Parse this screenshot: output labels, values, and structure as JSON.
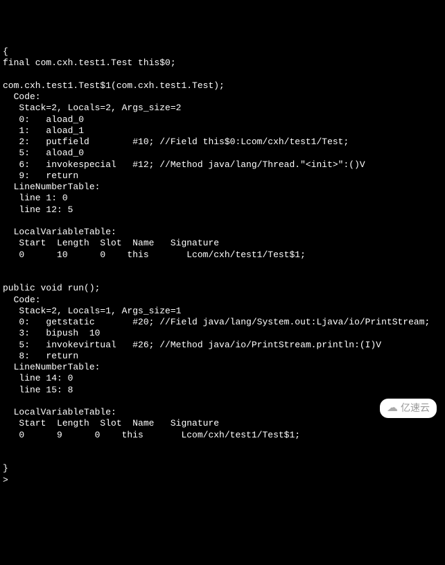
{
  "terminal": {
    "lines": [
      "{",
      "final com.cxh.test1.Test this$0;",
      "",
      "com.cxh.test1.Test$1(com.cxh.test1.Test);",
      "  Code:",
      "   Stack=2, Locals=2, Args_size=2",
      "   0:   aload_0",
      "   1:   aload_1",
      "   2:   putfield        #10; //Field this$0:Lcom/cxh/test1/Test;",
      "   5:   aload_0",
      "   6:   invokespecial   #12; //Method java/lang/Thread.\"<init>\":()V",
      "   9:   return",
      "  LineNumberTable:",
      "   line 1: 0",
      "   line 12: 5",
      "",
      "  LocalVariableTable:",
      "   Start  Length  Slot  Name   Signature",
      "   0      10      0    this       Lcom/cxh/test1/Test$1;",
      "",
      "",
      "public void run();",
      "  Code:",
      "   Stack=2, Locals=1, Args_size=1",
      "   0:   getstatic       #20; //Field java/lang/System.out:Ljava/io/PrintStream;",
      "   3:   bipush  10",
      "   5:   invokevirtual   #26; //Method java/io/PrintStream.println:(I)V",
      "   8:   return",
      "  LineNumberTable:",
      "   line 14: 0",
      "   line 15: 8",
      "",
      "  LocalVariableTable:",
      "   Start  Length  Slot  Name   Signature",
      "   0      9      0    this       Lcom/cxh/test1/Test$1;",
      "",
      "",
      "}"
    ],
    "prompt_char": ">"
  },
  "watermark": {
    "icon": "☁",
    "text": "亿速云"
  }
}
